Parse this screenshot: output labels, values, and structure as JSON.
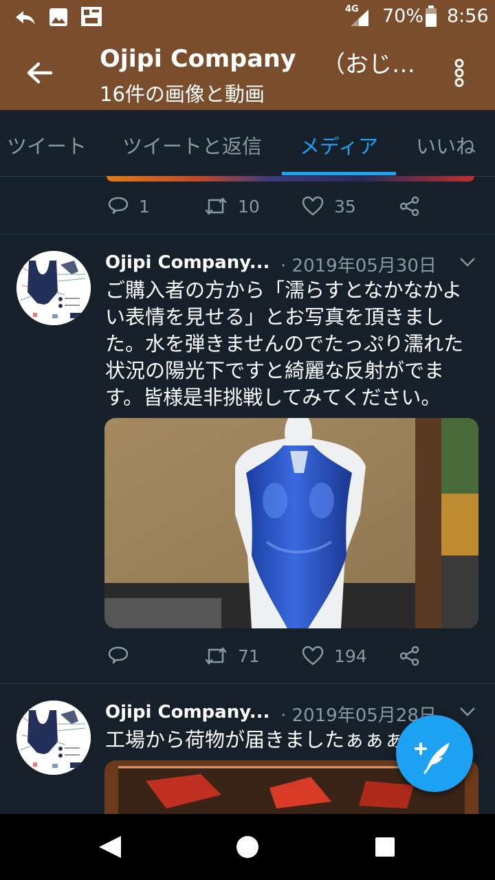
{
  "status_bar": {
    "network": "4G",
    "battery": "70%",
    "time": "8:56",
    "icons": [
      "reply-notification-icon",
      "image-notification-icon",
      "app-notification-icon",
      "signal-icon",
      "battery-icon"
    ]
  },
  "header": {
    "title": "Ojipi Company",
    "title_suffix": "（おじ…",
    "subtitle": "16件の画像と動画"
  },
  "tabs": [
    {
      "label": "ツイート",
      "active": false
    },
    {
      "label": "ツイートと返信",
      "active": false
    },
    {
      "label": "メディア",
      "active": true
    },
    {
      "label": "いいね",
      "active": false
    }
  ],
  "accent_color": "#1da1f2",
  "tweets": [
    {
      "replies": "1",
      "retweets": "10",
      "likes": "35"
    },
    {
      "name": "Ojipi Company...",
      "date": "· 2019年05月30日",
      "text": "ご購入者の方から「濡らすとなかなかよい表情を見せる」とお写真を頂きました。水を弾きませんのでたっぷり濡れた状況の陽光下ですと綺麗な反射がでます。皆様是非挑戦してみてください。",
      "replies": "",
      "retweets": "71",
      "likes": "194"
    },
    {
      "name": "Ojipi Company...",
      "date": "· 2019年05月28日",
      "text": "工場から荷物が届きましたぁぁぁ"
    }
  ]
}
